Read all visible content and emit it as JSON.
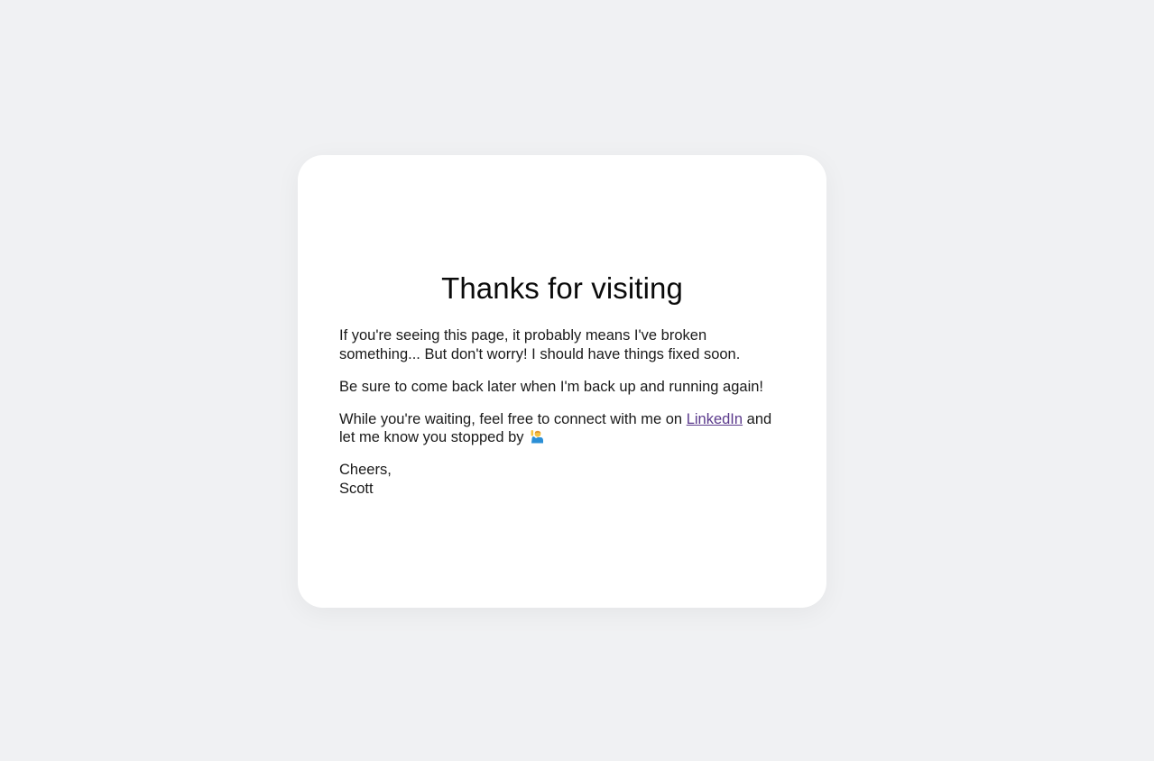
{
  "card": {
    "title": "Thanks for visiting",
    "paragraph_1": "If you're seeing this page, it probably means I've broken something... But don't worry! I should have things fixed soon.",
    "paragraph_2": "Be sure to come back later when I'm back up and running again!",
    "paragraph_3_before_link": "While you're waiting, feel free to connect with me on ",
    "linkedin_link": "LinkedIn",
    "paragraph_3_after_link": " and let me know you stopped by ",
    "wave_emoji_icon": "person-raising-hand-icon",
    "signoff": "Cheers,",
    "signature": "Scott"
  },
  "colors": {
    "page_background": "#f0f1f3",
    "card_background": "#ffffff",
    "link": "#5b3a8c",
    "text": "#1a1a1a"
  }
}
